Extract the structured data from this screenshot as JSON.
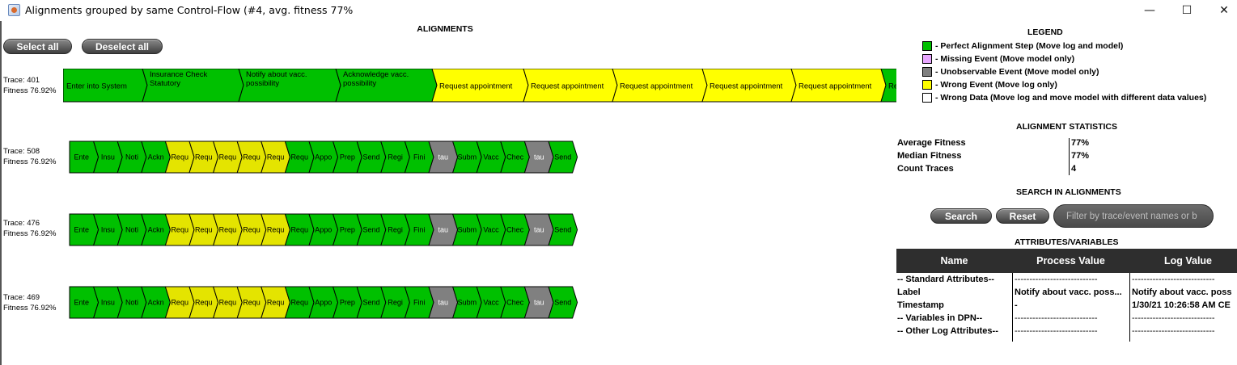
{
  "window": {
    "title": "Alignments grouped by same Control-Flow (#4, avg. fitness 77%",
    "minimize": "—",
    "maximize": "☐",
    "close": "✕",
    "app_icon": "java-app-icon"
  },
  "main": {
    "title": "ALIGNMENTS",
    "select_all": "Select all",
    "deselect_all": "Deselect all"
  },
  "colors": {
    "perfect": "#00c000",
    "missing": "#e8a6ff",
    "unobservable": "#808080",
    "wrong": "#ffff00",
    "wrong_compact": "#e4e400",
    "wrong_data": "#ffffff"
  },
  "traces": [
    {
      "id_label": "Trace: 401",
      "fitness_label": "Fitness 76.92%",
      "steps": [
        {
          "text": "Enter into System",
          "type": "perfect"
        },
        {
          "text": "Insurance Check\nStatutory",
          "type": "perfect"
        },
        {
          "text": "Notify about vacc.\npossibility",
          "type": "perfect"
        },
        {
          "text": "Acknowledge vacc.\npossibility",
          "type": "perfect"
        },
        {
          "text": "Request appointment",
          "type": "wrong"
        },
        {
          "text": "Request appointment",
          "type": "wrong"
        },
        {
          "text": "Request appointment",
          "type": "wrong"
        },
        {
          "text": "Request appointment",
          "type": "wrong"
        },
        {
          "text": "Request appointment",
          "type": "wrong"
        },
        {
          "text": "Re",
          "type": "perfect"
        }
      ]
    },
    {
      "id_label": "Trace: 508",
      "fitness_label": "Fitness 76.92%",
      "steps": [
        {
          "text": "Ente",
          "type": "perfect"
        },
        {
          "text": "Insu",
          "type": "perfect"
        },
        {
          "text": "Noti",
          "type": "perfect"
        },
        {
          "text": "Ackn",
          "type": "perfect"
        },
        {
          "text": "Requ",
          "type": "wrong"
        },
        {
          "text": "Requ",
          "type": "wrong"
        },
        {
          "text": "Requ",
          "type": "wrong"
        },
        {
          "text": "Requ",
          "type": "wrong"
        },
        {
          "text": "Requ",
          "type": "wrong"
        },
        {
          "text": "Requ",
          "type": "perfect"
        },
        {
          "text": "Appo",
          "type": "perfect"
        },
        {
          "text": "Prep",
          "type": "perfect"
        },
        {
          "text": "Send",
          "type": "perfect"
        },
        {
          "text": "Regi",
          "type": "perfect"
        },
        {
          "text": "Fini",
          "type": "perfect"
        },
        {
          "text": "tau",
          "type": "unobservable"
        },
        {
          "text": "Subm",
          "type": "perfect"
        },
        {
          "text": "Vacc",
          "type": "perfect"
        },
        {
          "text": "Chec",
          "type": "perfect"
        },
        {
          "text": "tau",
          "type": "unobservable"
        },
        {
          "text": "Send",
          "type": "perfect"
        }
      ]
    },
    {
      "id_label": "Trace: 476",
      "fitness_label": "Fitness 76.92%",
      "steps": [
        {
          "text": "Ente",
          "type": "perfect"
        },
        {
          "text": "Insu",
          "type": "perfect"
        },
        {
          "text": "Noti",
          "type": "perfect"
        },
        {
          "text": "Ackn",
          "type": "perfect"
        },
        {
          "text": "Requ",
          "type": "wrong"
        },
        {
          "text": "Requ",
          "type": "wrong"
        },
        {
          "text": "Requ",
          "type": "wrong"
        },
        {
          "text": "Requ",
          "type": "wrong"
        },
        {
          "text": "Requ",
          "type": "wrong"
        },
        {
          "text": "Requ",
          "type": "perfect"
        },
        {
          "text": "Appo",
          "type": "perfect"
        },
        {
          "text": "Prep",
          "type": "perfect"
        },
        {
          "text": "Send",
          "type": "perfect"
        },
        {
          "text": "Regi",
          "type": "perfect"
        },
        {
          "text": "Fini",
          "type": "perfect"
        },
        {
          "text": "tau",
          "type": "unobservable"
        },
        {
          "text": "Subm",
          "type": "perfect"
        },
        {
          "text": "Vacc",
          "type": "perfect"
        },
        {
          "text": "Chec",
          "type": "perfect"
        },
        {
          "text": "tau",
          "type": "unobservable"
        },
        {
          "text": "Send",
          "type": "perfect"
        }
      ]
    },
    {
      "id_label": "Trace: 469",
      "fitness_label": "Fitness 76.92%",
      "steps": [
        {
          "text": "Ente",
          "type": "perfect"
        },
        {
          "text": "Insu",
          "type": "perfect"
        },
        {
          "text": "Noti",
          "type": "perfect"
        },
        {
          "text": "Ackn",
          "type": "perfect"
        },
        {
          "text": "Requ",
          "type": "wrong"
        },
        {
          "text": "Requ",
          "type": "wrong"
        },
        {
          "text": "Requ",
          "type": "wrong"
        },
        {
          "text": "Requ",
          "type": "wrong"
        },
        {
          "text": "Requ",
          "type": "wrong"
        },
        {
          "text": "Requ",
          "type": "perfect"
        },
        {
          "text": "Appo",
          "type": "perfect"
        },
        {
          "text": "Prep",
          "type": "perfect"
        },
        {
          "text": "Send",
          "type": "perfect"
        },
        {
          "text": "Regi",
          "type": "perfect"
        },
        {
          "text": "Fini",
          "type": "perfect"
        },
        {
          "text": "tau",
          "type": "unobservable"
        },
        {
          "text": "Subm",
          "type": "perfect"
        },
        {
          "text": "Vacc",
          "type": "perfect"
        },
        {
          "text": "Chec",
          "type": "perfect"
        },
        {
          "text": "tau",
          "type": "unobservable"
        },
        {
          "text": "Send",
          "type": "perfect"
        }
      ]
    }
  ],
  "legend": {
    "title": "LEGEND",
    "items": [
      {
        "label": "- Perfect Alignment Step (Move log and model)",
        "color": "#00c000"
      },
      {
        "label": "- Missing Event (Move model only)",
        "color": "#e8a6ff"
      },
      {
        "label": "- Unobservable Event (Move model only)",
        "color": "#808080"
      },
      {
        "label": "- Wrong Event (Move log only)",
        "color": "#ffff00"
      },
      {
        "label": "- Wrong Data (Move log and move model with different data values)",
        "color": "#ffffff"
      }
    ]
  },
  "stats": {
    "title": "ALIGNMENT STATISTICS",
    "rows": [
      {
        "label": "Average Fitness",
        "value": "77%"
      },
      {
        "label": "Median Fitness",
        "value": "77%"
      },
      {
        "label": "Count Traces",
        "value": "4"
      }
    ]
  },
  "search": {
    "title": "SEARCH IN ALIGNMENTS",
    "search_label": "Search",
    "reset_label": "Reset",
    "placeholder": "Filter by trace/event names or b"
  },
  "attributes": {
    "title": "ATTRIBUTES/VARIABLES",
    "headers": [
      "Name",
      "Process Value",
      "Log Value"
    ],
    "rows": [
      [
        "-- Standard Attributes--",
        "----------------------------",
        "----------------------------"
      ],
      [
        "Label",
        "Notify about vacc. poss...",
        "Notify about vacc. poss"
      ],
      [
        "Timestamp",
        "-",
        "1/30/21 10:26:58 AM CE"
      ],
      [
        "-- Variables in DPN--",
        "----------------------------",
        "----------------------------"
      ],
      [
        "-- Other Log Attributes--",
        "----------------------------",
        "----------------------------"
      ]
    ]
  }
}
